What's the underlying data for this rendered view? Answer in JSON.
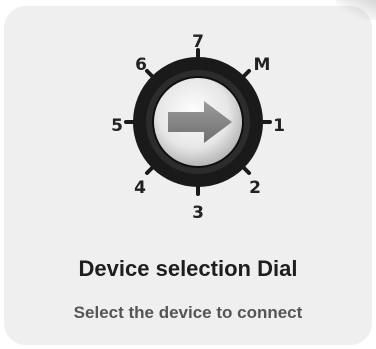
{
  "dial": {
    "positions": [
      "7",
      "M",
      "1",
      "2",
      "3",
      "4",
      "5",
      "6"
    ],
    "selected_icon": "right-arrow-icon"
  },
  "card": {
    "title": "Device selection Dial",
    "subtitle": "Select the device to connect"
  },
  "colors": {
    "card_background": "#efefef",
    "dial_ring": "#1a1a1a",
    "arrow": "#8a8a8a",
    "text_primary": "#1e1e1e",
    "text_secondary": "#555555"
  }
}
